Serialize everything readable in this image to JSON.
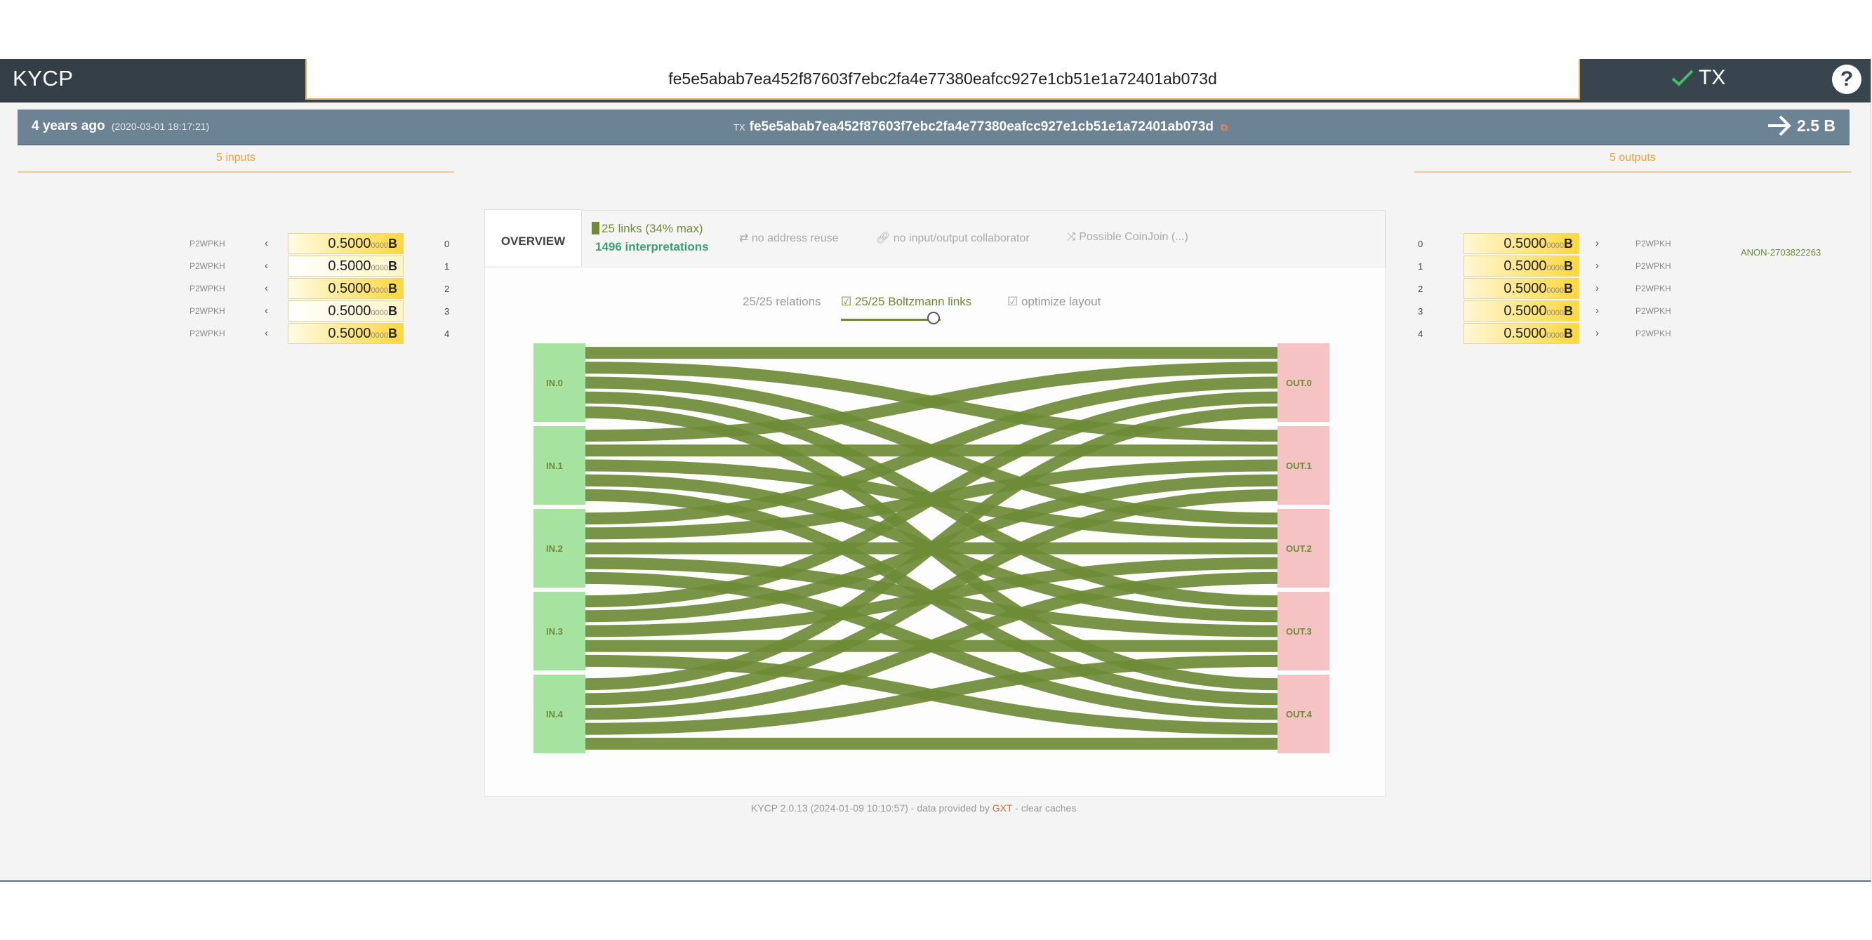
{
  "header": {
    "brand": "KYCP",
    "search_value": "fe5e5abab7ea452f87603f7ebc2fa4e77380eafcc927e1cb51e1a72401ab073d",
    "tx_button": "TX",
    "help": "?"
  },
  "txbar": {
    "age": "4 years ago",
    "date": "(2020-03-01 18:17:21)",
    "tx_label": "TX",
    "txid": "fe5e5abab7ea452f87603f7ebc2fa4e77380eafcc927e1cb51e1a72401ab073d",
    "total": "2.5 B"
  },
  "inputs": {
    "heading": "5 inputs",
    "items": [
      {
        "type": "P2WPKH",
        "main": "0.5000",
        "sub": "0000",
        "unit": "B",
        "index": "0"
      },
      {
        "type": "P2WPKH",
        "main": "0.5000",
        "sub": "0000",
        "unit": "B",
        "index": "1"
      },
      {
        "type": "P2WPKH",
        "main": "0.5000",
        "sub": "0000",
        "unit": "B",
        "index": "2"
      },
      {
        "type": "P2WPKH",
        "main": "0.5000",
        "sub": "0000",
        "unit": "B",
        "index": "3"
      },
      {
        "type": "P2WPKH",
        "main": "0.5000",
        "sub": "0000",
        "unit": "B",
        "index": "4"
      }
    ]
  },
  "outputs": {
    "heading": "5 outputs",
    "items": [
      {
        "type": "P2WPKH",
        "main": "0.5000",
        "sub": "0000",
        "unit": "B",
        "index": "0"
      },
      {
        "type": "P2WPKH",
        "main": "0.5000",
        "sub": "0000",
        "unit": "B",
        "index": "1"
      },
      {
        "type": "P2WPKH",
        "main": "0.5000",
        "sub": "0000",
        "unit": "B",
        "index": "2"
      },
      {
        "type": "P2WPKH",
        "main": "0.5000",
        "sub": "0000",
        "unit": "B",
        "index": "3"
      },
      {
        "type": "P2WPKH",
        "main": "0.5000",
        "sub": "0000",
        "unit": "B",
        "index": "4"
      }
    ],
    "annotation": "ANON-2703822263"
  },
  "overview": {
    "tab": "OVERVIEW",
    "links": "25 links (34% max)",
    "interpretations": "1496 interpretations",
    "flags": [
      "no address reuse",
      "no input/output collaborator",
      "Possible CoinJoin (...)"
    ],
    "relations": "25/25 relations",
    "boltzmann": "25/25 Boltzmann links",
    "optimize": "optimize layout",
    "slider_level": 0.93
  },
  "diagram": {
    "inputs": [
      "IN.0",
      "IN.1",
      "IN.2",
      "IN.3",
      "IN.4"
    ],
    "outputs": [
      "OUT.0",
      "OUT.1",
      "OUT.2",
      "OUT.3",
      "OUT.4"
    ],
    "link_count": 25,
    "colors": {
      "link": "#6e8b36",
      "input": "#a6e3a0",
      "output": "#f5c3c3",
      "label": "#6e8b36"
    }
  },
  "footer": {
    "version": "KYCP 2.0.13 (2024-01-09 10:10:57) - data provided by ",
    "provider": "GXT",
    "rest": " - clear caches"
  },
  "colors": {
    "topbar": "#38454f",
    "accent": "#e8a33d",
    "link_green": "#6e8b36"
  }
}
